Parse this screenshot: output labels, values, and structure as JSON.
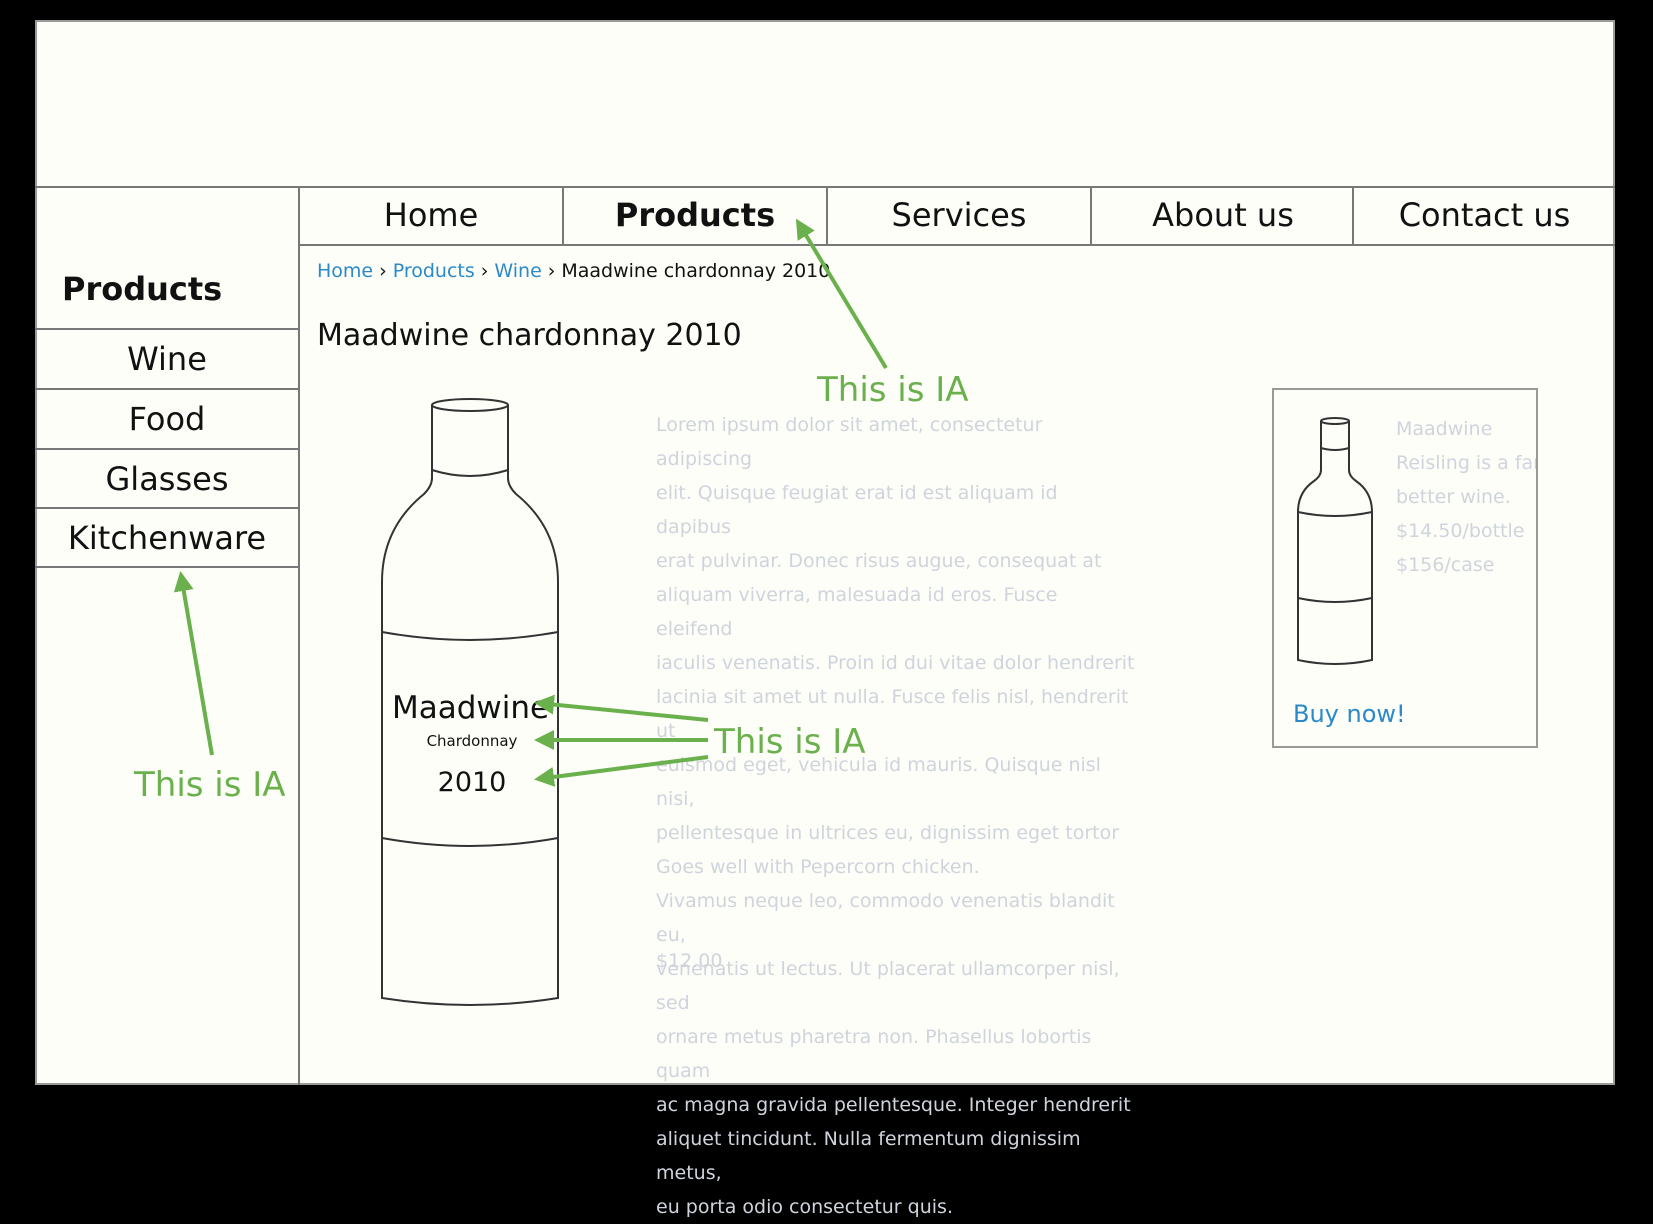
{
  "nav": {
    "home": "Home",
    "products": "Products",
    "services": "Services",
    "about": "About us",
    "contact": "Contact us"
  },
  "sidebar": {
    "title": "Products",
    "items": [
      {
        "label": "Wine"
      },
      {
        "label": "Food"
      },
      {
        "label": "Glasses"
      },
      {
        "label": "Kitchenware"
      }
    ]
  },
  "breadcrumb": {
    "home": "Home",
    "products": "Products",
    "wine": "Wine",
    "current": "Maadwine chardonnay 2010"
  },
  "product": {
    "title": "Maadwine chardonnay 2010",
    "label_brand": "Maadwine",
    "label_variety": "Chardonnay",
    "label_year": "2010",
    "description_lines": [
      "Lorem ipsum dolor sit amet, consectetur adipiscing",
      "elit. Quisque feugiat erat id est aliquam id dapibus",
      "erat pulvinar. Donec risus augue, consequat at",
      "aliquam viverra, malesuada id eros. Fusce eleifend",
      "iaculis venenatis. Proin id dui vitae dolor hendrerit",
      "lacinia sit amet ut nulla. Fusce felis nisl, hendrerit ut",
      "euismod eget, vehicula id mauris. Quisque nisl nisi,",
      "pellentesque in ultrices eu, dignissim eget tortor",
      "Goes well with Pepercorn chicken.",
      "Vivamus neque leo, commodo venenatis blandit eu,",
      "venenatis ut lectus. Ut placerat ullamcorper nisl, sed",
      "ornare metus pharetra non. Phasellus lobortis quam",
      "ac magna gravida pellentesque. Integer hendrerit",
      "aliquet tincidunt. Nulla fermentum dignissim metus,",
      "eu porta odio consectetur quis."
    ],
    "price": "$12.00"
  },
  "promo": {
    "lines": [
      "Maadwine",
      "Reisling is a far",
      "better wine.",
      "$14.50/bottle",
      "$156/case"
    ],
    "buy_label": "Buy now!"
  },
  "annotations": {
    "label": "This is IA",
    "color": "#6ab04c"
  },
  "colors": {
    "link": "#2a8ac9",
    "faded_text": "#cfd4dc",
    "border": "#777777"
  }
}
